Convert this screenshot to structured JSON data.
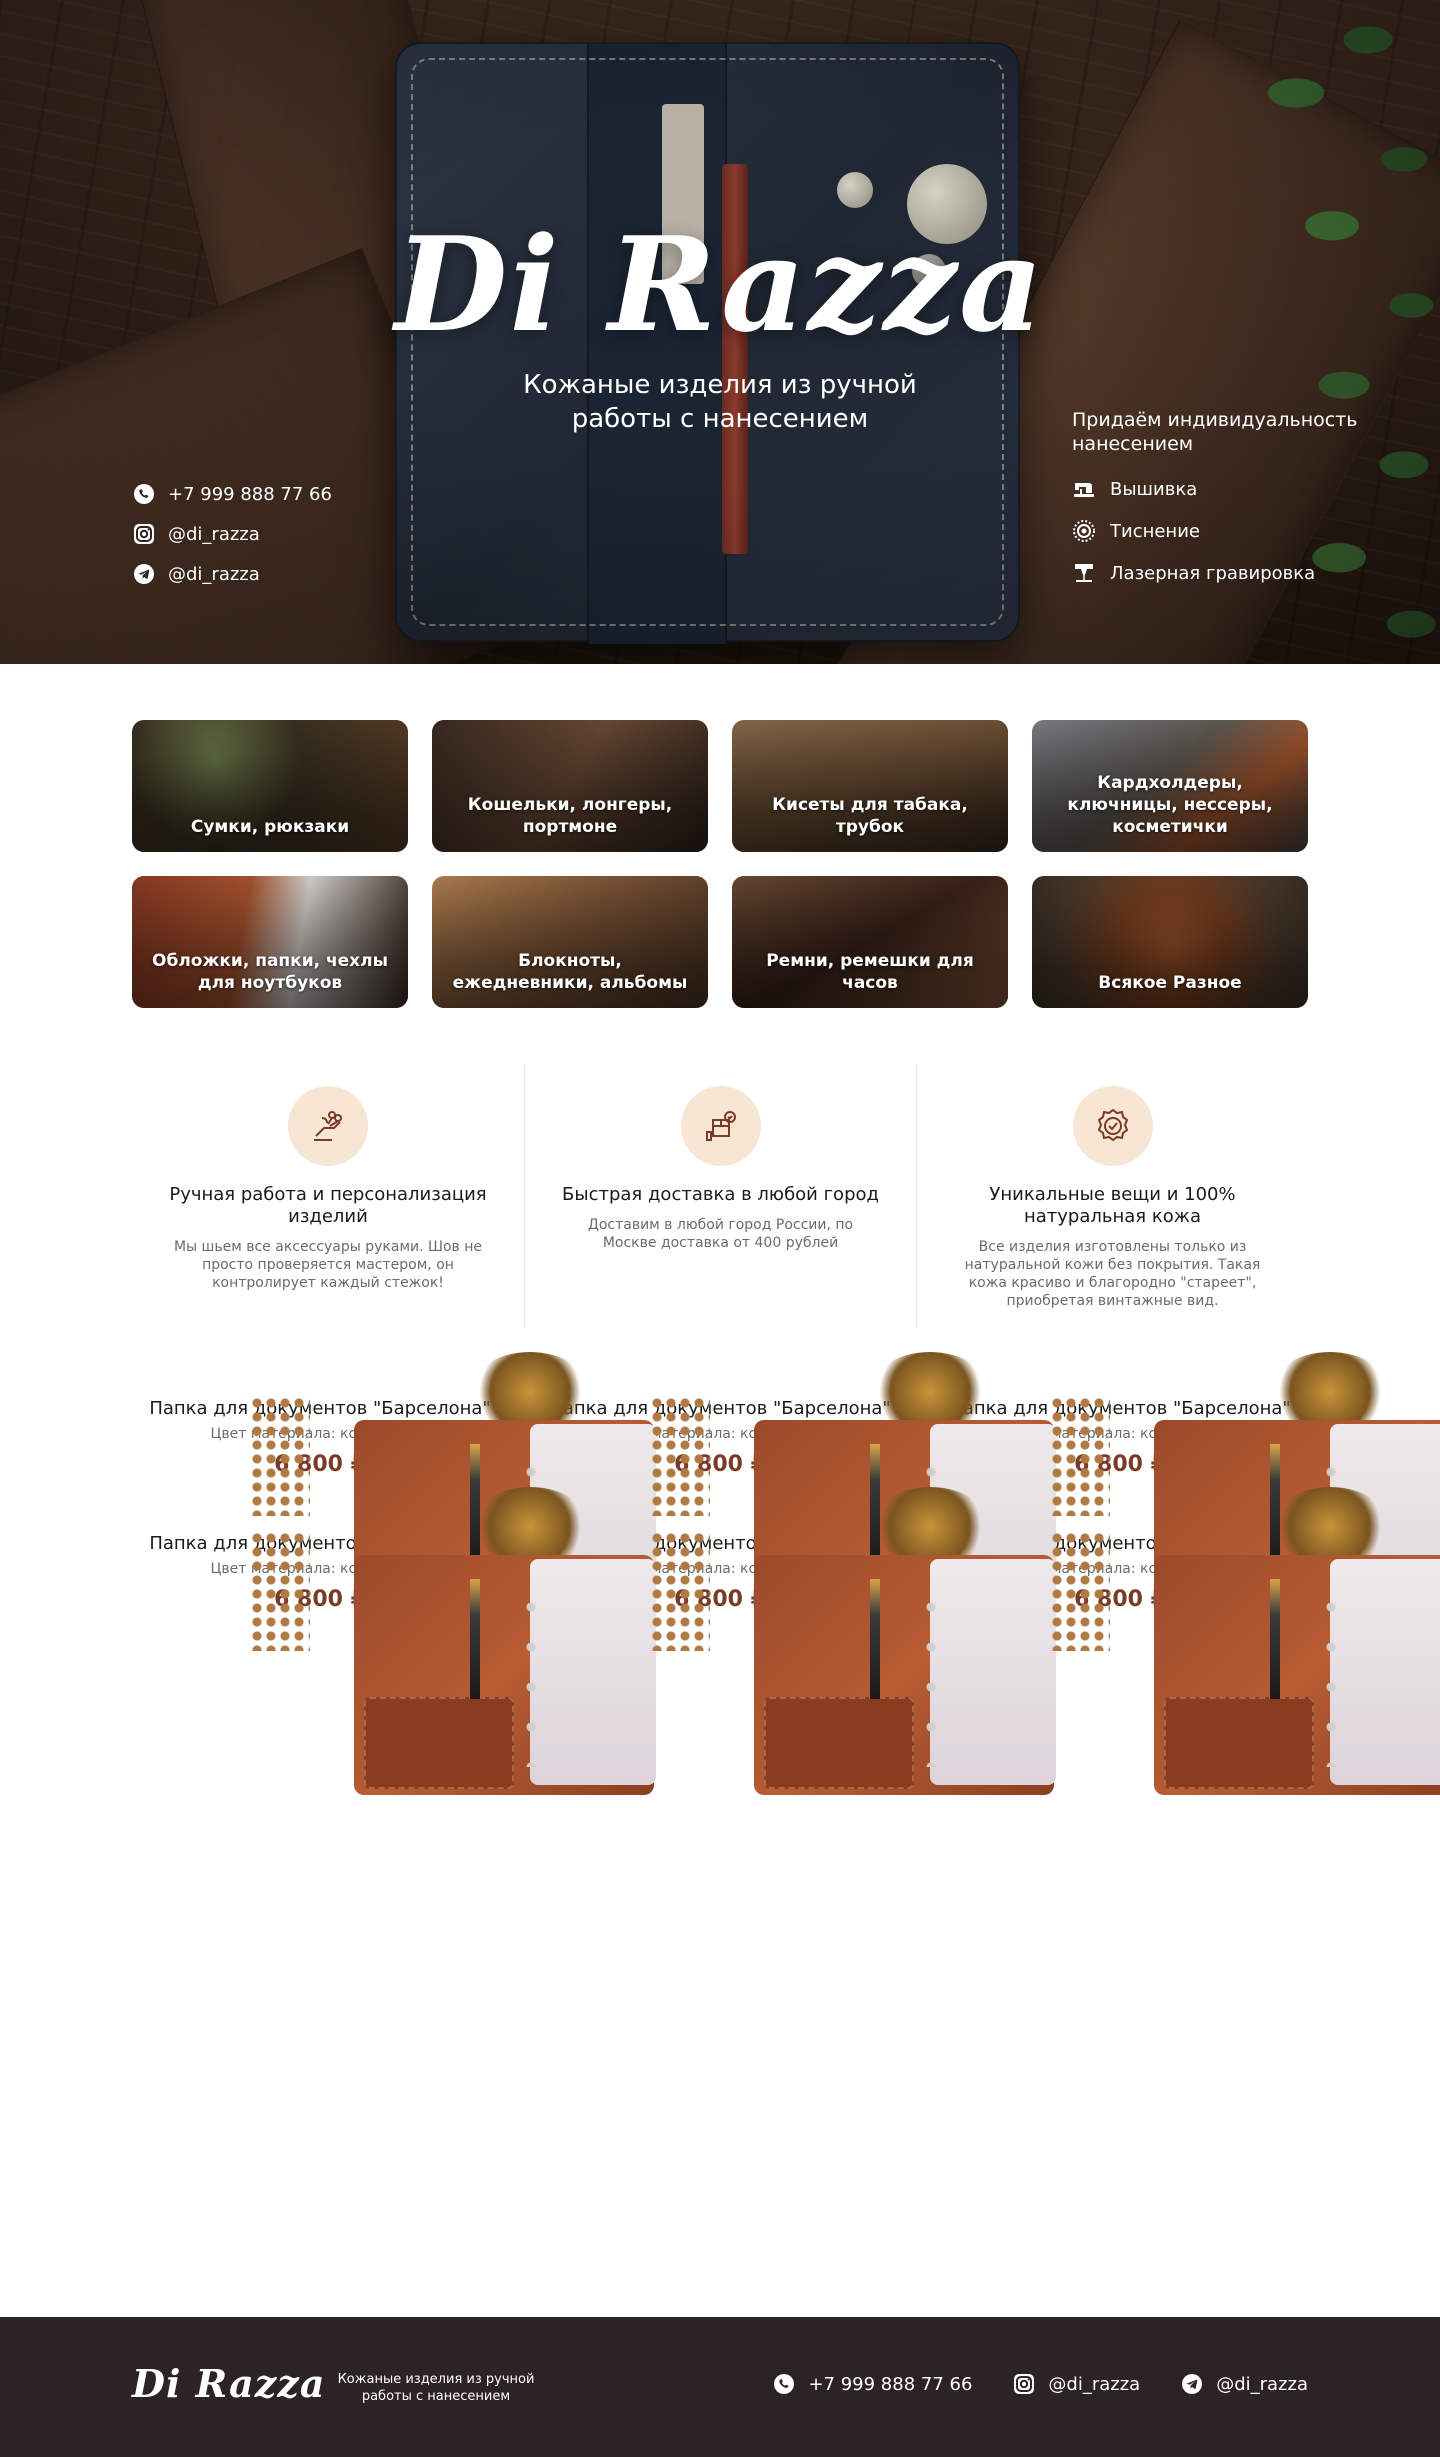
{
  "hero": {
    "brand": "Di Razza",
    "tagline": "Кожаные изделия из ручной работы с нанесением",
    "contacts": [
      {
        "icon": "whatsapp-icon",
        "text": "+7 999 888 77 66"
      },
      {
        "icon": "instagram-icon",
        "text": "@di_razza"
      },
      {
        "icon": "telegram-icon",
        "text": "@di_razza"
      }
    ],
    "services_heading": "Придаём индивидуальность нанесением",
    "services": [
      {
        "icon": "sewing-machine-icon",
        "label": "Вышивка"
      },
      {
        "icon": "embossing-stamp-icon",
        "label": "Тиснение"
      },
      {
        "icon": "laser-engraving-icon",
        "label": "Лазерная гравировка"
      }
    ]
  },
  "categories": [
    {
      "label": "Сумки, рюкзаки"
    },
    {
      "label": "Кошельки, лонгеры, портмоне"
    },
    {
      "label": "Кисеты для табака, трубок"
    },
    {
      "label": "Кардхолдеры, ключницы, нессеры, косметички"
    },
    {
      "label": "Обложки, папки, чехлы для ноутбуков"
    },
    {
      "label": "Блокноты, ежедневники, альбомы"
    },
    {
      "label": "Ремни, ремешки для часов"
    },
    {
      "label": "Всякое Разное"
    }
  ],
  "features": [
    {
      "icon": "handmade-scissors-icon",
      "title": "Ручная работа и персонализация изделий",
      "desc": "Мы шьем все аксессуары руками. Шов не просто проверяется мастером, он контролирует каждый стежок!"
    },
    {
      "icon": "delivery-box-icon",
      "title": "Быстрая доставка в любой город",
      "desc": "Доставим в любой город России, по Москве доставка от 400 рублей"
    },
    {
      "icon": "quality-badge-icon",
      "title": "Уникальные вещи и 100% натуральная кожа",
      "desc": "Все изделия изготовлены только из натуральной кожи без покрытия. Такая кожа красиво и благородно \"стареет\", приобретая винтажные вид."
    }
  ],
  "products": [
    {
      "name": "Папка для документов \"Барселона\"",
      "color": "Цвет материала: коричневый",
      "price": "6 800 ₽"
    },
    {
      "name": "Папка для документов \"Барселона\"",
      "color": "Цвет материала: коричневый",
      "price": "6 800 ₽"
    },
    {
      "name": "Папка для документов \"Барселона\"",
      "color": "Цвет материала: коричневый",
      "price": "6 800 ₽"
    },
    {
      "name": "Папка для документов \"Барселона\"",
      "color": "Цвет материала: коричневый",
      "price": "6 800 ₽"
    },
    {
      "name": "Папка для документов \"Барселона\"",
      "color": "Цвет материала: коричневый",
      "price": "6 800 ₽"
    },
    {
      "name": "Папка для документов \"Барселона\"",
      "color": "Цвет материала: коричневый",
      "price": "6 800 ₽"
    }
  ],
  "footer": {
    "brand": "Di Razza",
    "tagline": "Кожаные изделия из ручной работы с нанесением",
    "contacts": [
      {
        "icon": "whatsapp-icon",
        "text": "+7 999 888 77 66"
      },
      {
        "icon": "instagram-icon",
        "text": "@di_razza"
      },
      {
        "icon": "telegram-icon",
        "text": "@di_razza"
      }
    ]
  },
  "colors": {
    "accent_price": "#7a3b26",
    "feature_circle": "#f6e6d3",
    "footer_bg": "#2b2422"
  }
}
